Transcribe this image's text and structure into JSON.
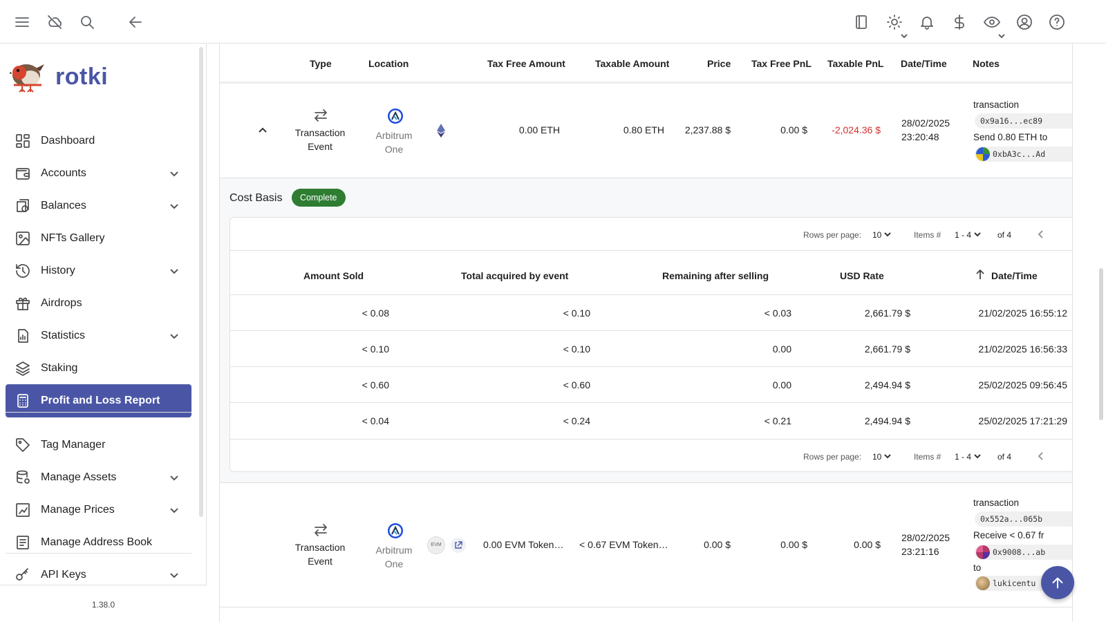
{
  "app": {
    "name": "rotki",
    "version": "1.38.0"
  },
  "sidebar": {
    "items": [
      {
        "label": "Dashboard",
        "icon": "dashboard-icon",
        "expandable": false
      },
      {
        "label": "Accounts",
        "icon": "wallet-icon",
        "expandable": true
      },
      {
        "label": "Balances",
        "icon": "balances-icon",
        "expandable": true
      },
      {
        "label": "NFTs Gallery",
        "icon": "image-icon",
        "expandable": false
      },
      {
        "label": "History",
        "icon": "history-icon",
        "expandable": true
      },
      {
        "label": "Airdrops",
        "icon": "gift-icon",
        "expandable": false
      },
      {
        "label": "Statistics",
        "icon": "statistics-icon",
        "expandable": true
      },
      {
        "label": "Staking",
        "icon": "staking-icon",
        "expandable": false
      },
      {
        "label": "Profit and Loss Report",
        "icon": "calculator-icon",
        "expandable": false,
        "active": true
      },
      {
        "label": "Tag Manager",
        "icon": "tag-icon",
        "expandable": false
      },
      {
        "label": "Manage Assets",
        "icon": "database-icon",
        "expandable": true
      },
      {
        "label": "Manage Prices",
        "icon": "prices-icon",
        "expandable": true
      },
      {
        "label": "Manage Address Book",
        "icon": "address-book-icon",
        "expandable": false
      },
      {
        "label": "API Keys",
        "icon": "key-icon",
        "expandable": true
      }
    ]
  },
  "table": {
    "headers": {
      "type": "Type",
      "location": "Location",
      "tax_free_amount": "Tax Free Amount",
      "taxable_amount": "Taxable Amount",
      "price": "Price",
      "tax_free_pnl": "Tax Free PnL",
      "taxable_pnl": "Taxable PnL",
      "datetime": "Date/Time",
      "notes": "Notes"
    },
    "rows": [
      {
        "type_line1": "Transaction",
        "type_line2": "Event",
        "location_line1": "Arbitrum",
        "location_line2": "One",
        "tax_free_amount": "0.00 ETH",
        "taxable_amount": "0.80 ETH",
        "price": "2,237.88 $",
        "tax_free_pnl": "0.00 $",
        "taxable_pnl": "-2,024.36 $",
        "date": "28/02/2025",
        "time": "23:20:48",
        "notes_title": "transaction",
        "notes_hash": "0x9a16...ec89",
        "notes_text": "Send 0.80 ETH to",
        "notes_address": "0xbA3c...Ad"
      },
      {
        "type_line1": "Transaction",
        "type_line2": "Event",
        "location_line1": "Arbitrum",
        "location_line2": "One",
        "asset_badge": "EVM",
        "tax_free_amount": "0.00 EVM Token…",
        "taxable_amount": "< 0.67 EVM Token…",
        "price": "0.00 $",
        "tax_free_pnl": "0.00 $",
        "taxable_pnl": "0.00 $",
        "date": "28/02/2025",
        "time": "23:21:16",
        "notes_title": "transaction",
        "notes_hash": "0x552a...065b",
        "notes_text": "Receive < 0.67 fr",
        "notes_address": "0x9008...ab",
        "notes_to": "to",
        "notes_to_name": "lukicentu"
      }
    ]
  },
  "cost_basis": {
    "title": "Cost Basis",
    "status": "Complete",
    "pager": {
      "rows_per_page_label": "Rows per page:",
      "rows_per_page": "10",
      "items_label": "Items #",
      "items_range": "1 - 4",
      "of_total": "of 4"
    },
    "headers": {
      "amount_sold": "Amount Sold",
      "total_acquired": "Total acquired by event",
      "remaining": "Remaining after selling",
      "usd_rate": "USD Rate",
      "datetime": "Date/Time"
    },
    "rows": [
      {
        "amount_sold": "< 0.08",
        "total_acquired": "< 0.10",
        "remaining": "< 0.03",
        "usd_rate": "2,661.79 $",
        "datetime": "21/02/2025 16:55:12"
      },
      {
        "amount_sold": "< 0.10",
        "total_acquired": "< 0.10",
        "remaining": "0.00",
        "usd_rate": "2,661.79 $",
        "datetime": "21/02/2025 16:56:33"
      },
      {
        "amount_sold": "< 0.60",
        "total_acquired": "< 0.60",
        "remaining": "0.00",
        "usd_rate": "2,494.94 $",
        "datetime": "25/02/2025 09:56:45"
      },
      {
        "amount_sold": "< 0.04",
        "total_acquired": "< 0.24",
        "remaining": "< 0.21",
        "usd_rate": "2,494.94 $",
        "datetime": "25/02/2025 17:21:29"
      }
    ]
  },
  "colors": {
    "brand": "#4a56a5",
    "negative": "#d32f2f",
    "complete": "#2e7d32"
  }
}
